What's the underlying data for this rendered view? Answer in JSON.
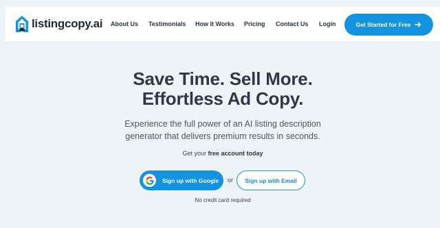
{
  "header": {
    "logo_text": "listingcopy.ai",
    "nav_items": [
      {
        "label": "About Us"
      },
      {
        "label": "Testimonials"
      },
      {
        "label": "How It Works"
      },
      {
        "label": "Pricing"
      },
      {
        "label": "Contact Us"
      },
      {
        "label": "Login"
      }
    ],
    "cta_label": "Get Started for Free",
    "cta_icon": "arrow-right-icon"
  },
  "hero": {
    "title_line1": "Save Time. Sell More.",
    "title_line2": "Effortless Ad Copy.",
    "subtitle_line1": "Experience the full power of an AI listing description",
    "subtitle_line2": "generator that delivers premium results in seconds.",
    "free_prefix": "Get your ",
    "free_bold": "free account today",
    "google_button_label": "Sign up with Google",
    "google_icon": "google-icon",
    "or_text": "or",
    "email_button_label": "Sign up with Email",
    "no_credit_card": "No credit card required"
  },
  "colors": {
    "accent": "#1493e0",
    "background": "#eef3f8",
    "text_dark": "#2e3846"
  }
}
